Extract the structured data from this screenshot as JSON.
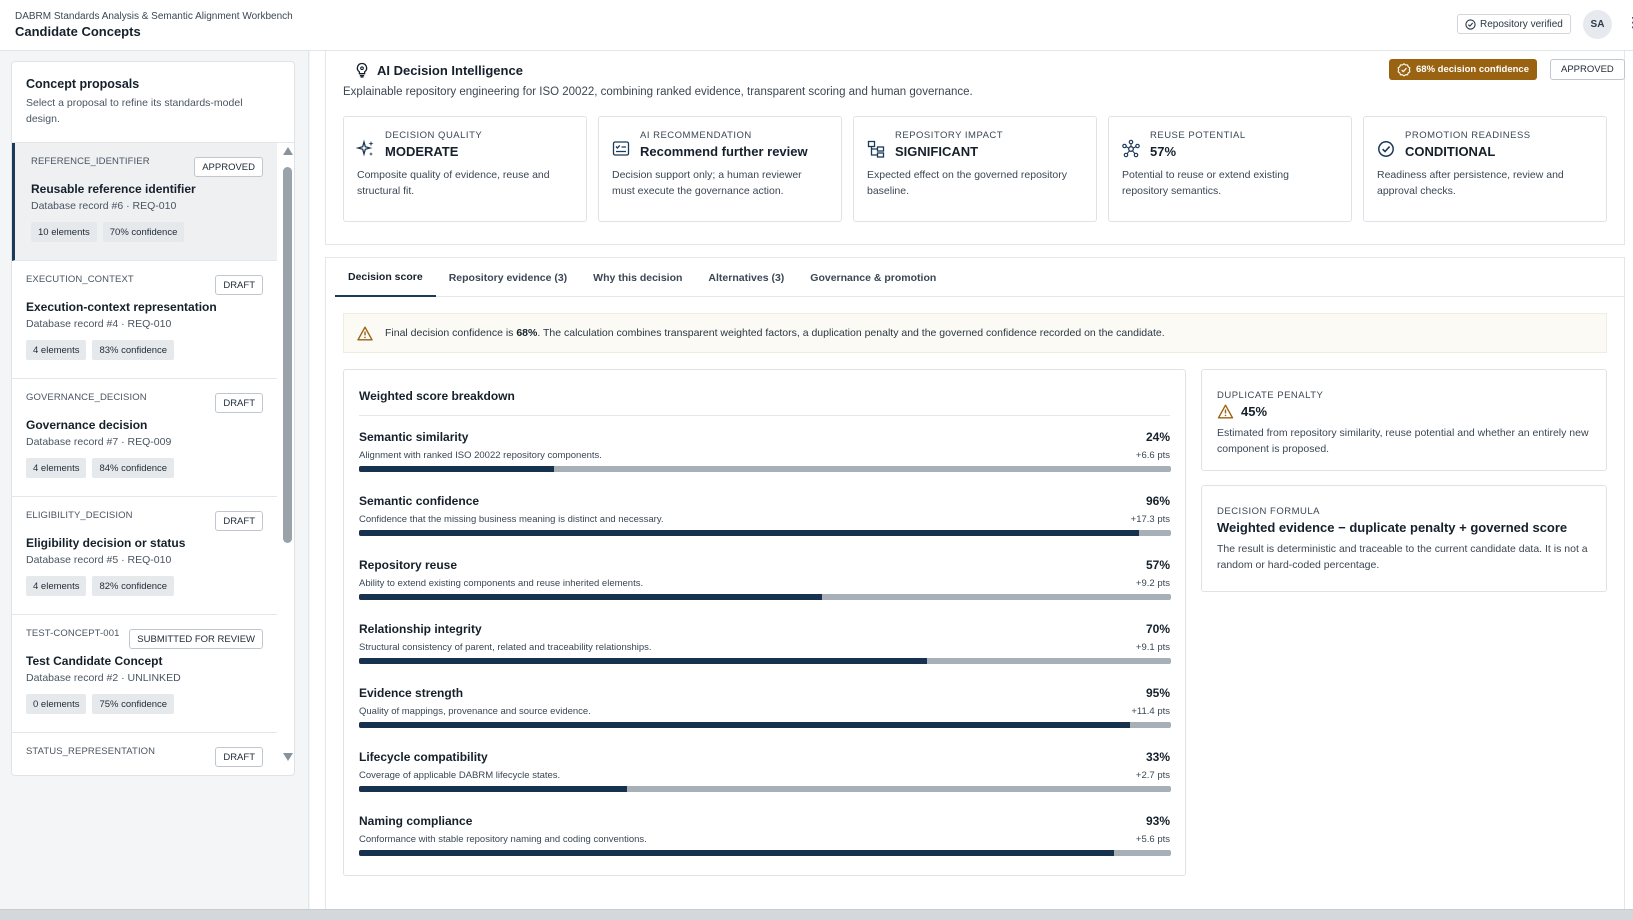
{
  "header": {
    "app_name": "DABRM Standards Analysis & Semantic Alignment Workbench",
    "page_title": "Candidate Concepts",
    "verified_label": "Repository verified",
    "avatar_initials": "SA"
  },
  "sidebar": {
    "title": "Concept proposals",
    "description": "Select a proposal to refine its standards-model design.",
    "items": [
      {
        "code": "REFERENCE_IDENTIFIER",
        "status": "APPROVED",
        "name": "Reusable reference identifier",
        "meta": "Database record #6 · REQ-010",
        "elements": "10 elements",
        "confidence": "70% confidence",
        "selected": true
      },
      {
        "code": "EXECUTION_CONTEXT",
        "status": "DRAFT",
        "name": "Execution-context representation",
        "meta": "Database record #4 · REQ-010",
        "elements": "4 elements",
        "confidence": "83% confidence"
      },
      {
        "code": "GOVERNANCE_DECISION",
        "status": "DRAFT",
        "name": "Governance decision",
        "meta": "Database record #7 · REQ-009",
        "elements": "4 elements",
        "confidence": "84% confidence"
      },
      {
        "code": "ELIGIBILITY_DECISION",
        "status": "DRAFT",
        "name": "Eligibility decision or status",
        "meta": "Database record #5 · REQ-010",
        "elements": "4 elements",
        "confidence": "82% confidence"
      },
      {
        "code": "TEST-CONCEPT-001",
        "status": "SUBMITTED FOR REVIEW",
        "name": "Test Candidate Concept",
        "meta": "Database record #2 · UNLINKED",
        "elements": "0 elements",
        "confidence": "75% confidence"
      },
      {
        "code": "STATUS_REPRESENTATION",
        "status": "DRAFT",
        "name": "",
        "meta": "",
        "elements": "",
        "confidence": ""
      }
    ]
  },
  "hero": {
    "title": "AI Decision Intelligence",
    "description": "Explainable repository engineering for ISO 20022, combining ranked evidence, transparent scoring and human governance.",
    "confidence_badge": "68% decision confidence",
    "status_badge": "APPROVED",
    "cards": [
      {
        "icon": "sparkle-icon",
        "label": "DECISION QUALITY",
        "value": "MODERATE",
        "desc": "Composite quality of evidence, reuse and structural fit."
      },
      {
        "icon": "checklist-icon",
        "label": "AI RECOMMENDATION",
        "value": "Recommend further review",
        "desc": "Decision support only; a human reviewer must execute the governance action."
      },
      {
        "icon": "hierarchy-icon",
        "label": "REPOSITORY IMPACT",
        "value": "SIGNIFICANT",
        "desc": "Expected effect on the governed repository baseline."
      },
      {
        "icon": "network-icon",
        "label": "REUSE POTENTIAL",
        "value": "57%",
        "desc": "Potential to reuse or extend existing repository semantics."
      },
      {
        "icon": "check-circle-icon",
        "label": "PROMOTION READINESS",
        "value": "CONDITIONAL",
        "desc": "Readiness after persistence, review and approval checks."
      }
    ]
  },
  "tabs": [
    "Decision score",
    "Repository evidence (3)",
    "Why this decision",
    "Alternatives (3)",
    "Governance & promotion"
  ],
  "alert": {
    "prefix": "Final decision confidence is ",
    "value": "68%",
    "suffix": ". The calculation combines transparent weighted factors, a duplication penalty and the governed confidence recorded on the candidate."
  },
  "breakdown": {
    "title": "Weighted score breakdown",
    "factors": [
      {
        "name": "Semantic similarity",
        "pct_label": "24%",
        "value": 24,
        "desc": "Alignment with ranked ISO 20022 repository components.",
        "pts": "+6.6 pts"
      },
      {
        "name": "Semantic confidence",
        "pct_label": "96%",
        "value": 96,
        "desc": "Confidence that the missing business meaning is distinct and necessary.",
        "pts": "+17.3 pts"
      },
      {
        "name": "Repository reuse",
        "pct_label": "57%",
        "value": 57,
        "desc": "Ability to extend existing components and reuse inherited elements.",
        "pts": "+9.2 pts"
      },
      {
        "name": "Relationship integrity",
        "pct_label": "70%",
        "value": 70,
        "desc": "Structural consistency of parent, related and traceability relationships.",
        "pts": "+9.1 pts"
      },
      {
        "name": "Evidence strength",
        "pct_label": "95%",
        "value": 95,
        "desc": "Quality of mappings, provenance and source evidence.",
        "pts": "+11.4 pts"
      },
      {
        "name": "Lifecycle compatibility",
        "pct_label": "33%",
        "value": 33,
        "desc": "Coverage of applicable DABRM lifecycle states.",
        "pts": "+2.7 pts"
      },
      {
        "name": "Naming compliance",
        "pct_label": "93%",
        "value": 93,
        "desc": "Conformance with stable repository naming and coding conventions.",
        "pts": "+5.6 pts"
      }
    ]
  },
  "duplicate_penalty": {
    "label": "DUPLICATE PENALTY",
    "value": "45%",
    "desc": "Estimated from repository similarity, reuse potential and whether an entirely new component is proposed."
  },
  "decision_formula": {
    "label": "DECISION FORMULA",
    "value": "Weighted evidence − duplicate penalty + governed score",
    "desc": "The result is deterministic and traceable to the current candidate data. It is not a random or hard-coded percentage."
  },
  "colors": {
    "accent": "#17324e",
    "badge": "#9a6311",
    "warning": "#9a6311"
  }
}
